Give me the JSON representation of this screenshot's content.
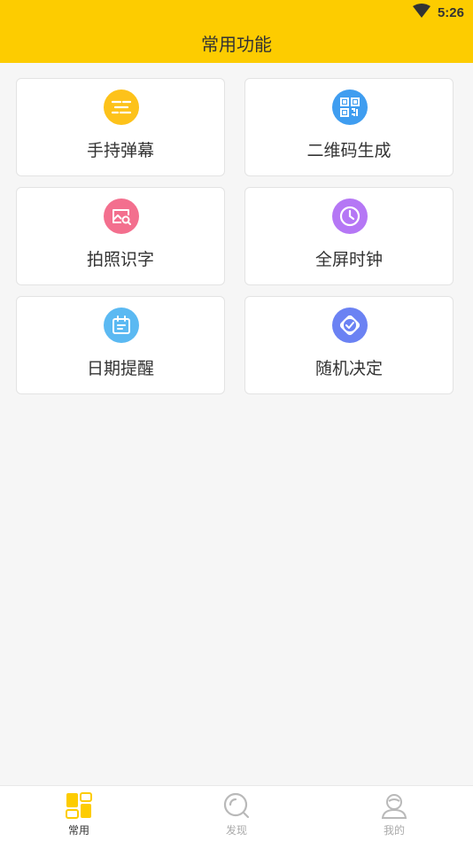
{
  "status_bar": {
    "time": "5:26",
    "wifi_icon": "wifi-icon"
  },
  "header": {
    "title": "常用功能"
  },
  "colors": {
    "accent": "#fdcc00",
    "danmaku": "#fdc21a",
    "qrcode": "#3f9df0",
    "ocr": "#f36f8e",
    "clock": "#b577f5",
    "reminder": "#5bb9f2",
    "random": "#6b82f3"
  },
  "features": [
    {
      "label": "手持弹幕",
      "icon": "danmaku-icon"
    },
    {
      "label": "二维码生成",
      "icon": "qrcode-icon"
    },
    {
      "label": "拍照识字",
      "icon": "photo-ocr-icon"
    },
    {
      "label": "全屏时钟",
      "icon": "clock-icon"
    },
    {
      "label": "日期提醒",
      "icon": "calendar-icon"
    },
    {
      "label": "随机决定",
      "icon": "random-icon"
    }
  ],
  "tabs": [
    {
      "label": "常用",
      "icon": "common-grid-icon",
      "active": true
    },
    {
      "label": "发现",
      "icon": "discover-icon",
      "active": false
    },
    {
      "label": "我的",
      "icon": "profile-icon",
      "active": false
    }
  ]
}
